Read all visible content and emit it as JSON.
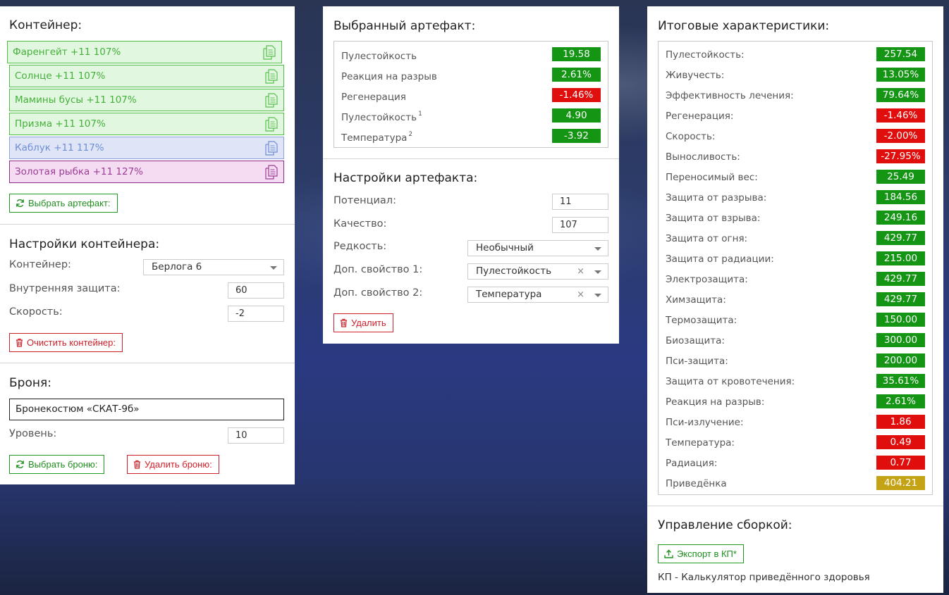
{
  "colors": {
    "green": "#149614",
    "red": "#e10e0e",
    "gold": "#c5a316"
  },
  "container_panel": {
    "title": "Контейнер:",
    "slots": [
      {
        "label": "Фаренгейт +11 107%",
        "color": "green"
      },
      {
        "label": "Солнце +11 107%",
        "color": "green"
      },
      {
        "label": "Мамины бусы +11 107%",
        "color": "green"
      },
      {
        "label": "Призма +11 107%",
        "color": "green"
      },
      {
        "label": "Каблук +11 117%",
        "color": "blue"
      },
      {
        "label": "Золотая рыбка +11 127%",
        "color": "purple"
      }
    ],
    "select_artifact_button": "Выбрать артефакт:"
  },
  "container_settings": {
    "title": "Настройки контейнера:",
    "container_label": "Контейнер:",
    "container_value": "Берлога 6",
    "protection_label": "Внутренняя защита:",
    "protection_value": "60",
    "speed_label": "Скорость:",
    "speed_value": "-2",
    "clear_button": "Очистить контейнер:"
  },
  "armor": {
    "title": "Броня:",
    "name": "Бронекостюм «СКАТ-9б»",
    "level_label": "Уровень:",
    "level_value": "10",
    "select_button": "Выбрать броню:",
    "delete_button": "Удалить броню:"
  },
  "selected_artifact": {
    "title": "Выбранный артефакт:",
    "stats": [
      {
        "name": "Пулестойкость",
        "sup": "",
        "value": "19.58",
        "color": "green"
      },
      {
        "name": "Реакция на разрыв",
        "sup": "",
        "value": "2.61%",
        "color": "green"
      },
      {
        "name": "Регенерация",
        "sup": "",
        "value": "-1.46%",
        "color": "red"
      },
      {
        "name": "Пулестойкость",
        "sup": "1",
        "value": "4.90",
        "color": "green"
      },
      {
        "name": "Температура",
        "sup": "2",
        "value": "-3.92",
        "color": "green"
      }
    ]
  },
  "artifact_settings": {
    "title": "Настройки артефакта:",
    "potential_label": "Потенциал:",
    "potential_value": "11",
    "quality_label": "Качество:",
    "quality_value": "107",
    "rarity_label": "Редкость:",
    "rarity_value": "Необычный",
    "extra1_label": "Доп. свойство 1:",
    "extra1_value": "Пулестойкость",
    "extra2_label": "Доп. свойство 2:",
    "extra2_value": "Температура",
    "clear_symbol": "×",
    "delete_button": "Удалить"
  },
  "totals": {
    "title": "Итоговые характеристики:",
    "stats": [
      {
        "name": "Пулестойкость:",
        "value": "257.54",
        "color": "green"
      },
      {
        "name": "Живучесть:",
        "value": "13.05%",
        "color": "green"
      },
      {
        "name": "Эффективность лечения:",
        "value": "79.64%",
        "color": "green"
      },
      {
        "name": "Регенерация:",
        "value": "-1.46%",
        "color": "red"
      },
      {
        "name": "Скорость:",
        "value": "-2.00%",
        "color": "red"
      },
      {
        "name": "Выносливость:",
        "value": "-27.95%",
        "color": "red"
      },
      {
        "name": "Переносимый вес:",
        "value": "25.49",
        "color": "green"
      },
      {
        "name": "Защита от разрыва:",
        "value": "184.56",
        "color": "green"
      },
      {
        "name": "Защита от взрыва:",
        "value": "249.16",
        "color": "green"
      },
      {
        "name": "Защита от огня:",
        "value": "429.77",
        "color": "green"
      },
      {
        "name": "Защита от радиации:",
        "value": "215.00",
        "color": "green"
      },
      {
        "name": "Электрозащита:",
        "value": "429.77",
        "color": "green"
      },
      {
        "name": "Химзащита:",
        "value": "429.77",
        "color": "green"
      },
      {
        "name": "Термозащита:",
        "value": "150.00",
        "color": "green"
      },
      {
        "name": "Биозащита:",
        "value": "300.00",
        "color": "green"
      },
      {
        "name": "Пси-защита:",
        "value": "200.00",
        "color": "green"
      },
      {
        "name": "Защита от кровотечения:",
        "value": "35.61%",
        "color": "green"
      },
      {
        "name": "Реакция на разрыв:",
        "value": "2.61%",
        "color": "green"
      },
      {
        "name": "Пси-излучение:",
        "value": "1.86",
        "color": "red"
      },
      {
        "name": "Температура:",
        "value": "0.49",
        "color": "red"
      },
      {
        "name": "Радиация:",
        "value": "0.77",
        "color": "red"
      },
      {
        "name": "Приведёнка",
        "value": "404.21",
        "color": "gold"
      }
    ]
  },
  "build": {
    "title": "Управление сборкой:",
    "export_button": "Экспорт в КП*",
    "note": "КП - Калькулятор приведённого здоровья"
  }
}
